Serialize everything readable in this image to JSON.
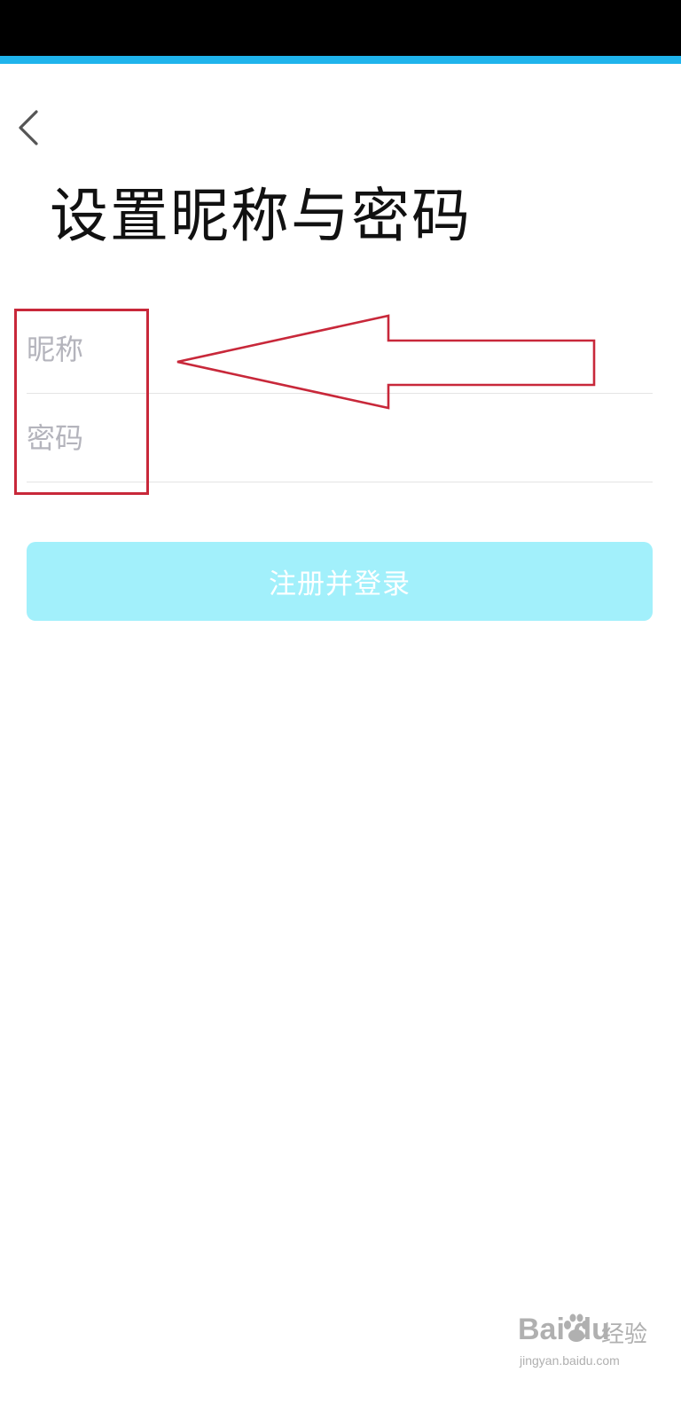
{
  "header": {
    "back_icon": "chevron-left-icon",
    "title": "设置昵称与密码"
  },
  "form": {
    "nickname": {
      "value": "",
      "placeholder": "昵称"
    },
    "password": {
      "value": "",
      "placeholder": "密码"
    },
    "submit_label": "注册并登录"
  },
  "watermark": {
    "brand": "Bai du",
    "brand_cn": "经验",
    "url": "jingyan.baidu.com"
  },
  "colors": {
    "status_bar": "#000000",
    "accent_line": "#1fb4ec",
    "button_bg": "#a2f0fb",
    "button_text": "#ffffff",
    "placeholder": "#b4b4bc",
    "annotation": "#c8283a"
  }
}
